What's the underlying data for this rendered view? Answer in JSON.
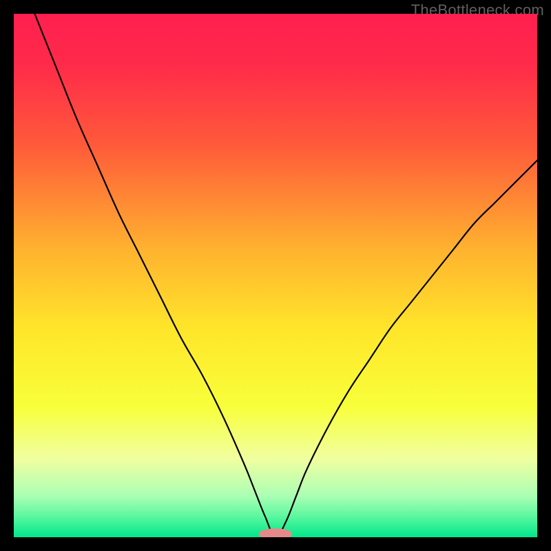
{
  "watermark": "TheBottleneck.com",
  "chart_data": {
    "type": "line",
    "title": "",
    "xlabel": "",
    "ylabel": "",
    "xlim": [
      0,
      100
    ],
    "ylim": [
      0,
      100
    ],
    "axes_visible": false,
    "grid": false,
    "background_gradient": {
      "stops": [
        {
          "offset": 0.0,
          "color": "#ff1f4f"
        },
        {
          "offset": 0.1,
          "color": "#ff2b4a"
        },
        {
          "offset": 0.25,
          "color": "#ff5a3a"
        },
        {
          "offset": 0.45,
          "color": "#ffb22f"
        },
        {
          "offset": 0.6,
          "color": "#ffe52a"
        },
        {
          "offset": 0.75,
          "color": "#f8ff3a"
        },
        {
          "offset": 0.85,
          "color": "#f0ffa0"
        },
        {
          "offset": 0.92,
          "color": "#acffb4"
        },
        {
          "offset": 0.96,
          "color": "#5cf7a0"
        },
        {
          "offset": 1.0,
          "color": "#00e78a"
        }
      ]
    },
    "series": [
      {
        "name": "bottleneck-curve",
        "stroke": "#000000",
        "stroke_width": 2.2,
        "x": [
          4,
          8,
          12,
          16,
          20,
          24,
          28,
          32,
          36,
          40,
          44,
          46,
          48,
          50,
          52,
          54,
          56,
          60,
          64,
          68,
          72,
          76,
          80,
          84,
          88,
          92,
          96,
          100
        ],
        "y": [
          100,
          90,
          80,
          71,
          62,
          54,
          46,
          38,
          31,
          23,
          14,
          9,
          4,
          0,
          3,
          8,
          13,
          21,
          28,
          34,
          40,
          45,
          50,
          55,
          60,
          64,
          68,
          72
        ]
      }
    ],
    "marker": {
      "name": "min-marker",
      "x": 50,
      "y": 0.6,
      "rx": 3.2,
      "ry": 1.1,
      "fill": "#e58a8a"
    }
  }
}
